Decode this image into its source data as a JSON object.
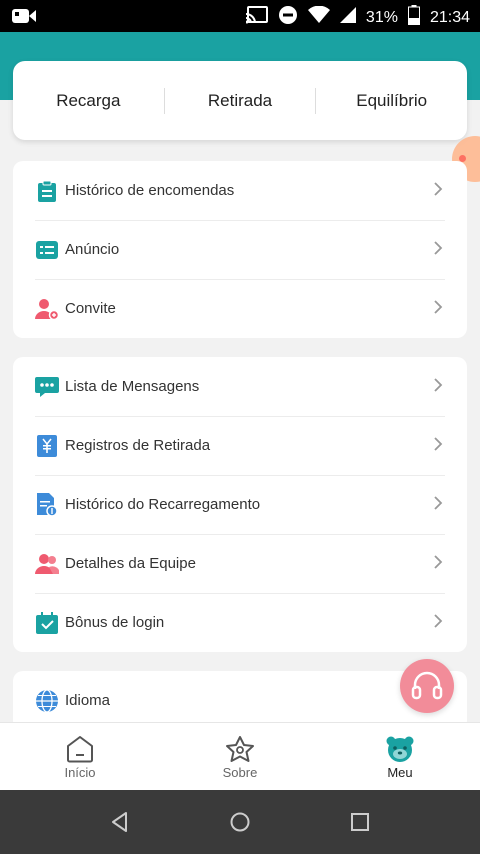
{
  "status_bar": {
    "battery_percent": "31%",
    "time": "21:34"
  },
  "actions": [
    {
      "label": "Recarga"
    },
    {
      "label": "Retirada"
    },
    {
      "label": "Equilíbrio"
    }
  ],
  "group1": [
    {
      "label": "Histórico de encomendas",
      "icon": "clipboard-icon",
      "color": "#1aa2a2"
    },
    {
      "label": "Anúncio",
      "icon": "announcement-icon",
      "color": "#1aa2a2"
    },
    {
      "label": "Convite",
      "icon": "invite-user-icon",
      "color": "#ef5a6f"
    }
  ],
  "group2": [
    {
      "label": "Lista de Mensagens",
      "icon": "chat-icon",
      "color": "#1aa2a2"
    },
    {
      "label": "Registros de Retirada",
      "icon": "withdraw-record-icon",
      "color": "#3d8bd9"
    },
    {
      "label": "Histórico do Recarregamento",
      "icon": "recharge-history-icon",
      "color": "#3d8bd9"
    },
    {
      "label": "Detalhes da Equipe",
      "icon": "team-icon",
      "color": "#ef5a6f"
    },
    {
      "label": "Bônus de login",
      "icon": "calendar-check-icon",
      "color": "#1aa2a2"
    }
  ],
  "group3": [
    {
      "label": "Idioma",
      "icon": "globe-icon",
      "color": "#3d8bd9"
    }
  ],
  "bottom_nav": [
    {
      "label": "Início",
      "icon": "home-icon"
    },
    {
      "label": "Sobre",
      "icon": "star-icon"
    },
    {
      "label": "Meu",
      "icon": "bear-icon"
    }
  ],
  "colors": {
    "accent": "#1aa2a2",
    "support": "#f28c99"
  }
}
